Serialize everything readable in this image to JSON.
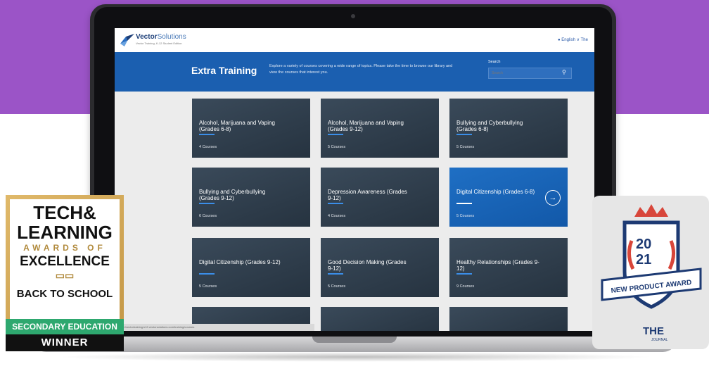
{
  "brand": {
    "name_bold": "Vector",
    "name_light": "Solutions",
    "tagline": "Vector Training, K-12 Student Edition"
  },
  "header": {
    "language": "English",
    "language_caret": "∨",
    "menu_partial": "The"
  },
  "hero": {
    "title": "Extra Training",
    "description": "Explore a variety of courses covering a wide range of topics. Please take the time to browse our library and view the courses that interest you.",
    "search_label": "Search",
    "search_placeholder": "Search"
  },
  "courses": [
    {
      "title": "Alcohol, Marijuana and Vaping (Grades 6-8)",
      "count": "4 Courses"
    },
    {
      "title": "Alcohol, Marijuana and Vaping (Grades 9-12)",
      "count": "5 Courses"
    },
    {
      "title": "Bullying and Cyberbullying (Grades 6-8)",
      "count": "5 Courses"
    },
    {
      "title": "Bullying and Cyberbullying (Grades 9-12)",
      "count": "6 Courses"
    },
    {
      "title": "Depression Awareness (Grades 9-12)",
      "count": "4 Courses"
    },
    {
      "title": "Digital Citizenship (Grades 6-8)",
      "count": "5 Courses"
    },
    {
      "title": "Digital Citizenship (Grades 9-12)",
      "count": "5 Courses"
    },
    {
      "title": "Good Decision Making (Grades 9-12)",
      "count": "5 Courses"
    },
    {
      "title": "Healthy Relationships (Grades 9-12)",
      "count": "9 Courses"
    }
  ],
  "active_card_arrow": "→",
  "status_url": "https://vectortraining.k12.vectorsolutions.com/training/courses",
  "badge_left": {
    "line1": "TECH&",
    "line2": "LEARNING",
    "line3": "AWARDS OF",
    "line4": "EXCELLENCE",
    "line5": "BACK TO SCHOOL",
    "line6": "SECONDARY EDUCATION",
    "line7": "WINNER"
  },
  "badge_right": {
    "year_top": "20",
    "year_bottom": "21",
    "ribbon": "NEW PRODUCT AWARD",
    "brand": "THE",
    "brand_sub": "JOURNAL"
  },
  "colors": {
    "background_band": "#9b54c7",
    "hero": "#1b5fb0",
    "active_card": "#1f6fc4",
    "badge_green": "#2ea86f",
    "badge_navy": "#1d3a73"
  }
}
